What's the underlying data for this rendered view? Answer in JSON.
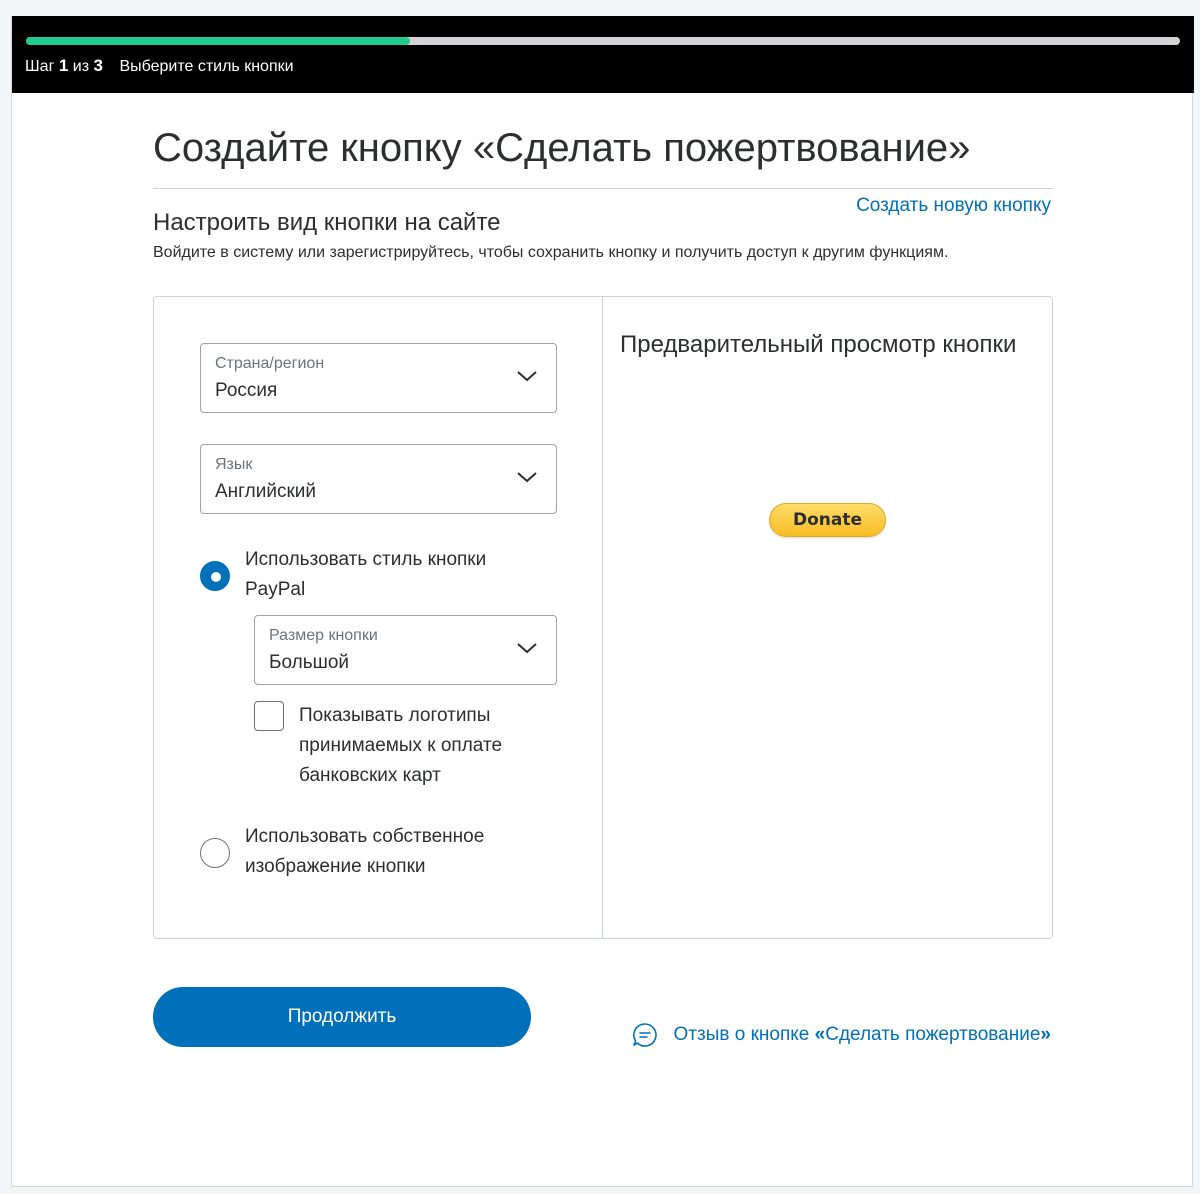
{
  "progress": {
    "fraction": 0.333
  },
  "step": {
    "word": "Шаг",
    "current": "1",
    "of": "из",
    "total": "3",
    "title": "Выберите стиль кнопки"
  },
  "page": {
    "title": "Создайте кнопку «Сделать пожертвование»",
    "new_button_link": "Создать новую кнопку",
    "section_title": "Настроить вид кнопки на сайте",
    "section_subtitle": "Войдите в систему или зарегистрируйтесь, чтобы сохранить кнопку и получить доступ к другим функциям."
  },
  "form": {
    "country": {
      "label": "Страна/регион",
      "value": "Россия"
    },
    "language": {
      "label": "Язык",
      "value": "Английский"
    },
    "option_paypal": {
      "label_line1": "Использовать стиль кнопки",
      "label_line2": "PayPal",
      "checked": true
    },
    "size": {
      "label": "Размер кнопки",
      "value": "Большой"
    },
    "card_logos": {
      "line1": "Показывать логотипы",
      "line2": "принимаемых к оплате",
      "line3": "банковских карт",
      "checked": false
    },
    "option_custom": {
      "label_line1": "Использовать собственное",
      "label_line2": "изображение кнопки",
      "checked": false
    }
  },
  "preview": {
    "title": "Предварительный просмотр кнопки",
    "donate_label": "Donate"
  },
  "footer": {
    "continue_label": "Продолжить",
    "feedback_prefix": "Отзыв о кнопке ",
    "feedback_open_quote": "«",
    "feedback_name": "Сделать пожертвование",
    "feedback_close_quote": "»"
  },
  "colors": {
    "accent": "#0070ba",
    "progress": "#1fcb8f",
    "donate": "#ffc439"
  },
  "icons": {
    "chevron": "chevron-down-icon",
    "feedback": "feedback-chat-icon"
  }
}
